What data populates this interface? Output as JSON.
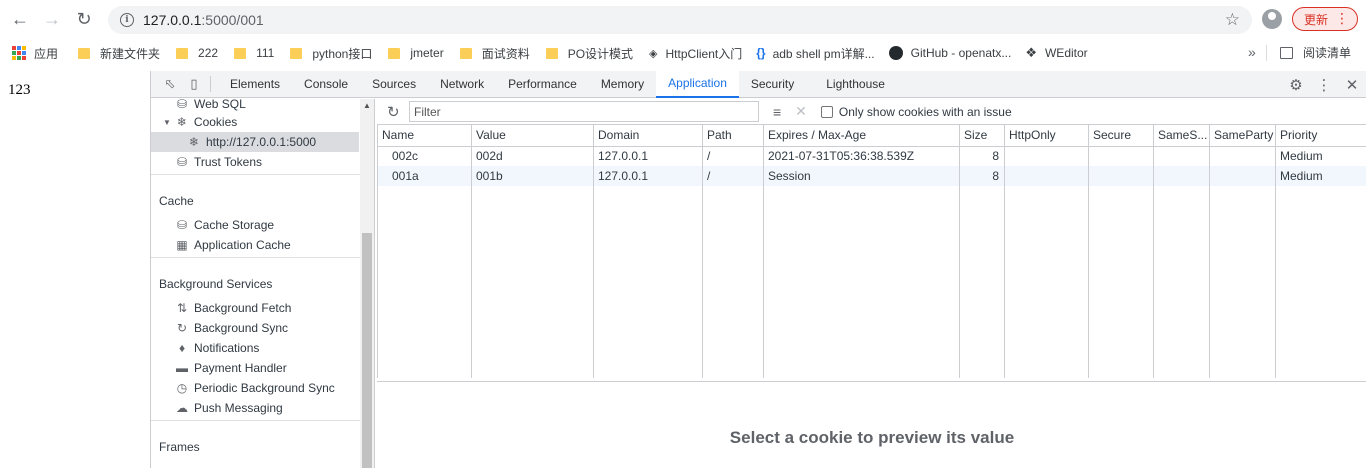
{
  "browser": {
    "url_host": "127.0.0.1",
    "url_path": ":5000/001",
    "update_label": "更新",
    "bookmarks": [
      "应用",
      "新建文件夹",
      "222",
      "111",
      "python接口",
      "jmeter",
      "面试资料",
      "PO设计模式",
      "HttpClient入门",
      "adb shell pm详解...",
      "GitHub - openatx...",
      "WEditor"
    ],
    "reading_list": "阅读清单"
  },
  "page": {
    "body_text": "123"
  },
  "devtools": {
    "tabs": [
      "Elements",
      "Console",
      "Sources",
      "Network",
      "Performance",
      "Memory",
      "Application",
      "Security",
      "Lighthouse"
    ],
    "active_tab": "Application",
    "sidebar": {
      "storage_items": [
        {
          "label": "Web SQL",
          "icon": "database-icon"
        },
        {
          "label": "Cookies",
          "icon": "cookie-icon"
        },
        {
          "label": "http://127.0.0.1:5000",
          "icon": "cookie-icon"
        },
        {
          "label": "Trust Tokens",
          "icon": "database-icon"
        }
      ],
      "cache_section": "Cache",
      "cache_items": [
        {
          "label": "Cache Storage",
          "icon": "database-icon"
        },
        {
          "label": "Application Cache",
          "icon": "grid-icon"
        }
      ],
      "background_section": "Background Services",
      "background_items": [
        {
          "label": "Background Fetch",
          "icon": "swap-arrows-icon"
        },
        {
          "label": "Background Sync",
          "icon": "sync-icon"
        },
        {
          "label": "Notifications",
          "icon": "bell-icon"
        },
        {
          "label": "Payment Handler",
          "icon": "card-icon"
        },
        {
          "label": "Periodic Background Sync",
          "icon": "clock-icon"
        },
        {
          "label": "Push Messaging",
          "icon": "cloud-icon"
        }
      ],
      "frames_section": "Frames"
    },
    "filter": {
      "placeholder": "Filter",
      "only_issues_label": "Only show cookies with an issue"
    },
    "cookies_table": {
      "columns": [
        "Name",
        "Value",
        "Domain",
        "Path",
        "Expires / Max-Age",
        "Size",
        "HttpOnly",
        "Secure",
        "SameS...",
        "SameParty",
        "Priority"
      ],
      "rows": [
        {
          "name": "002c",
          "value": "002d",
          "domain": "127.0.0.1",
          "path": "/",
          "expires": "2021-07-31T05:36:38.539Z",
          "size": "8",
          "httponly": "",
          "secure": "",
          "samesite": "",
          "sameparty": "",
          "priority": "Medium"
        },
        {
          "name": "001a",
          "value": "001b",
          "domain": "127.0.0.1",
          "path": "/",
          "expires": "Session",
          "size": "8",
          "httponly": "",
          "secure": "",
          "samesite": "",
          "sameparty": "",
          "priority": "Medium"
        }
      ]
    },
    "preview_text": "Select a cookie to preview its value"
  }
}
